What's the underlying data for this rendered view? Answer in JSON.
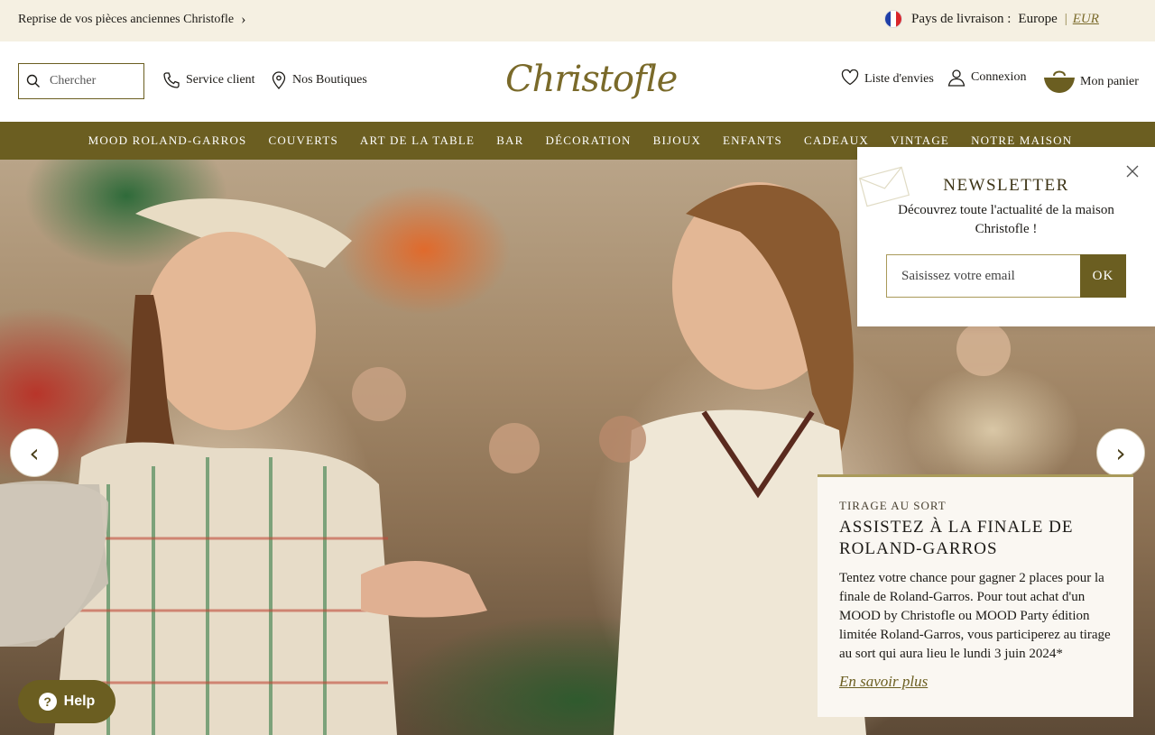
{
  "topbar": {
    "promo_text": "Reprise de vos pièces anciennes Christofle",
    "country_label": "Pays de livraison :",
    "country_value": "Europe",
    "separator": "|",
    "currency": "EUR"
  },
  "header": {
    "search_placeholder": "Chercher",
    "service_client": "Service client",
    "boutiques": "Nos Boutiques",
    "logo_text": "Christofle",
    "wishlist": "Liste d'envies",
    "login": "Connexion",
    "cart": "Mon panier"
  },
  "nav": {
    "items": [
      {
        "label": "MOOD ROLAND-GARROS"
      },
      {
        "label": "COUVERTS"
      },
      {
        "label": "ART DE LA TABLE"
      },
      {
        "label": "BAR"
      },
      {
        "label": "DÉCORATION"
      },
      {
        "label": "BIJOUX"
      },
      {
        "label": "ENFANTS"
      },
      {
        "label": "CADEAUX"
      },
      {
        "label": "VINTAGE"
      },
      {
        "label": "NOTRE MAISON"
      }
    ]
  },
  "hero": {
    "prev_label": "‹",
    "next_label": "›",
    "card": {
      "eyebrow": "TIRAGE AU SORT",
      "title": "ASSISTEZ À LA FINALE DE ROLAND-GARROS",
      "body": "Tentez votre chance pour gagner 2 places pour la finale de Roland-Garros. Pour tout achat d'un MOOD by Christofle ou MOOD Party édition limitée Roland-Garros, vous participerez au tirage au sort qui aura lieu le lundi 3 juin 2024*",
      "link": "En savoir plus"
    }
  },
  "newsletter": {
    "title": "NEWSLETTER",
    "text": "Découvrez toute l'actualité de la maison Christofle !",
    "email_placeholder": "Saisissez votre email",
    "ok_label": "OK"
  },
  "help": {
    "label": "Help",
    "icon": "?"
  },
  "colors": {
    "brand": "#6b5e21",
    "topbar_bg": "#f5f0e2"
  }
}
